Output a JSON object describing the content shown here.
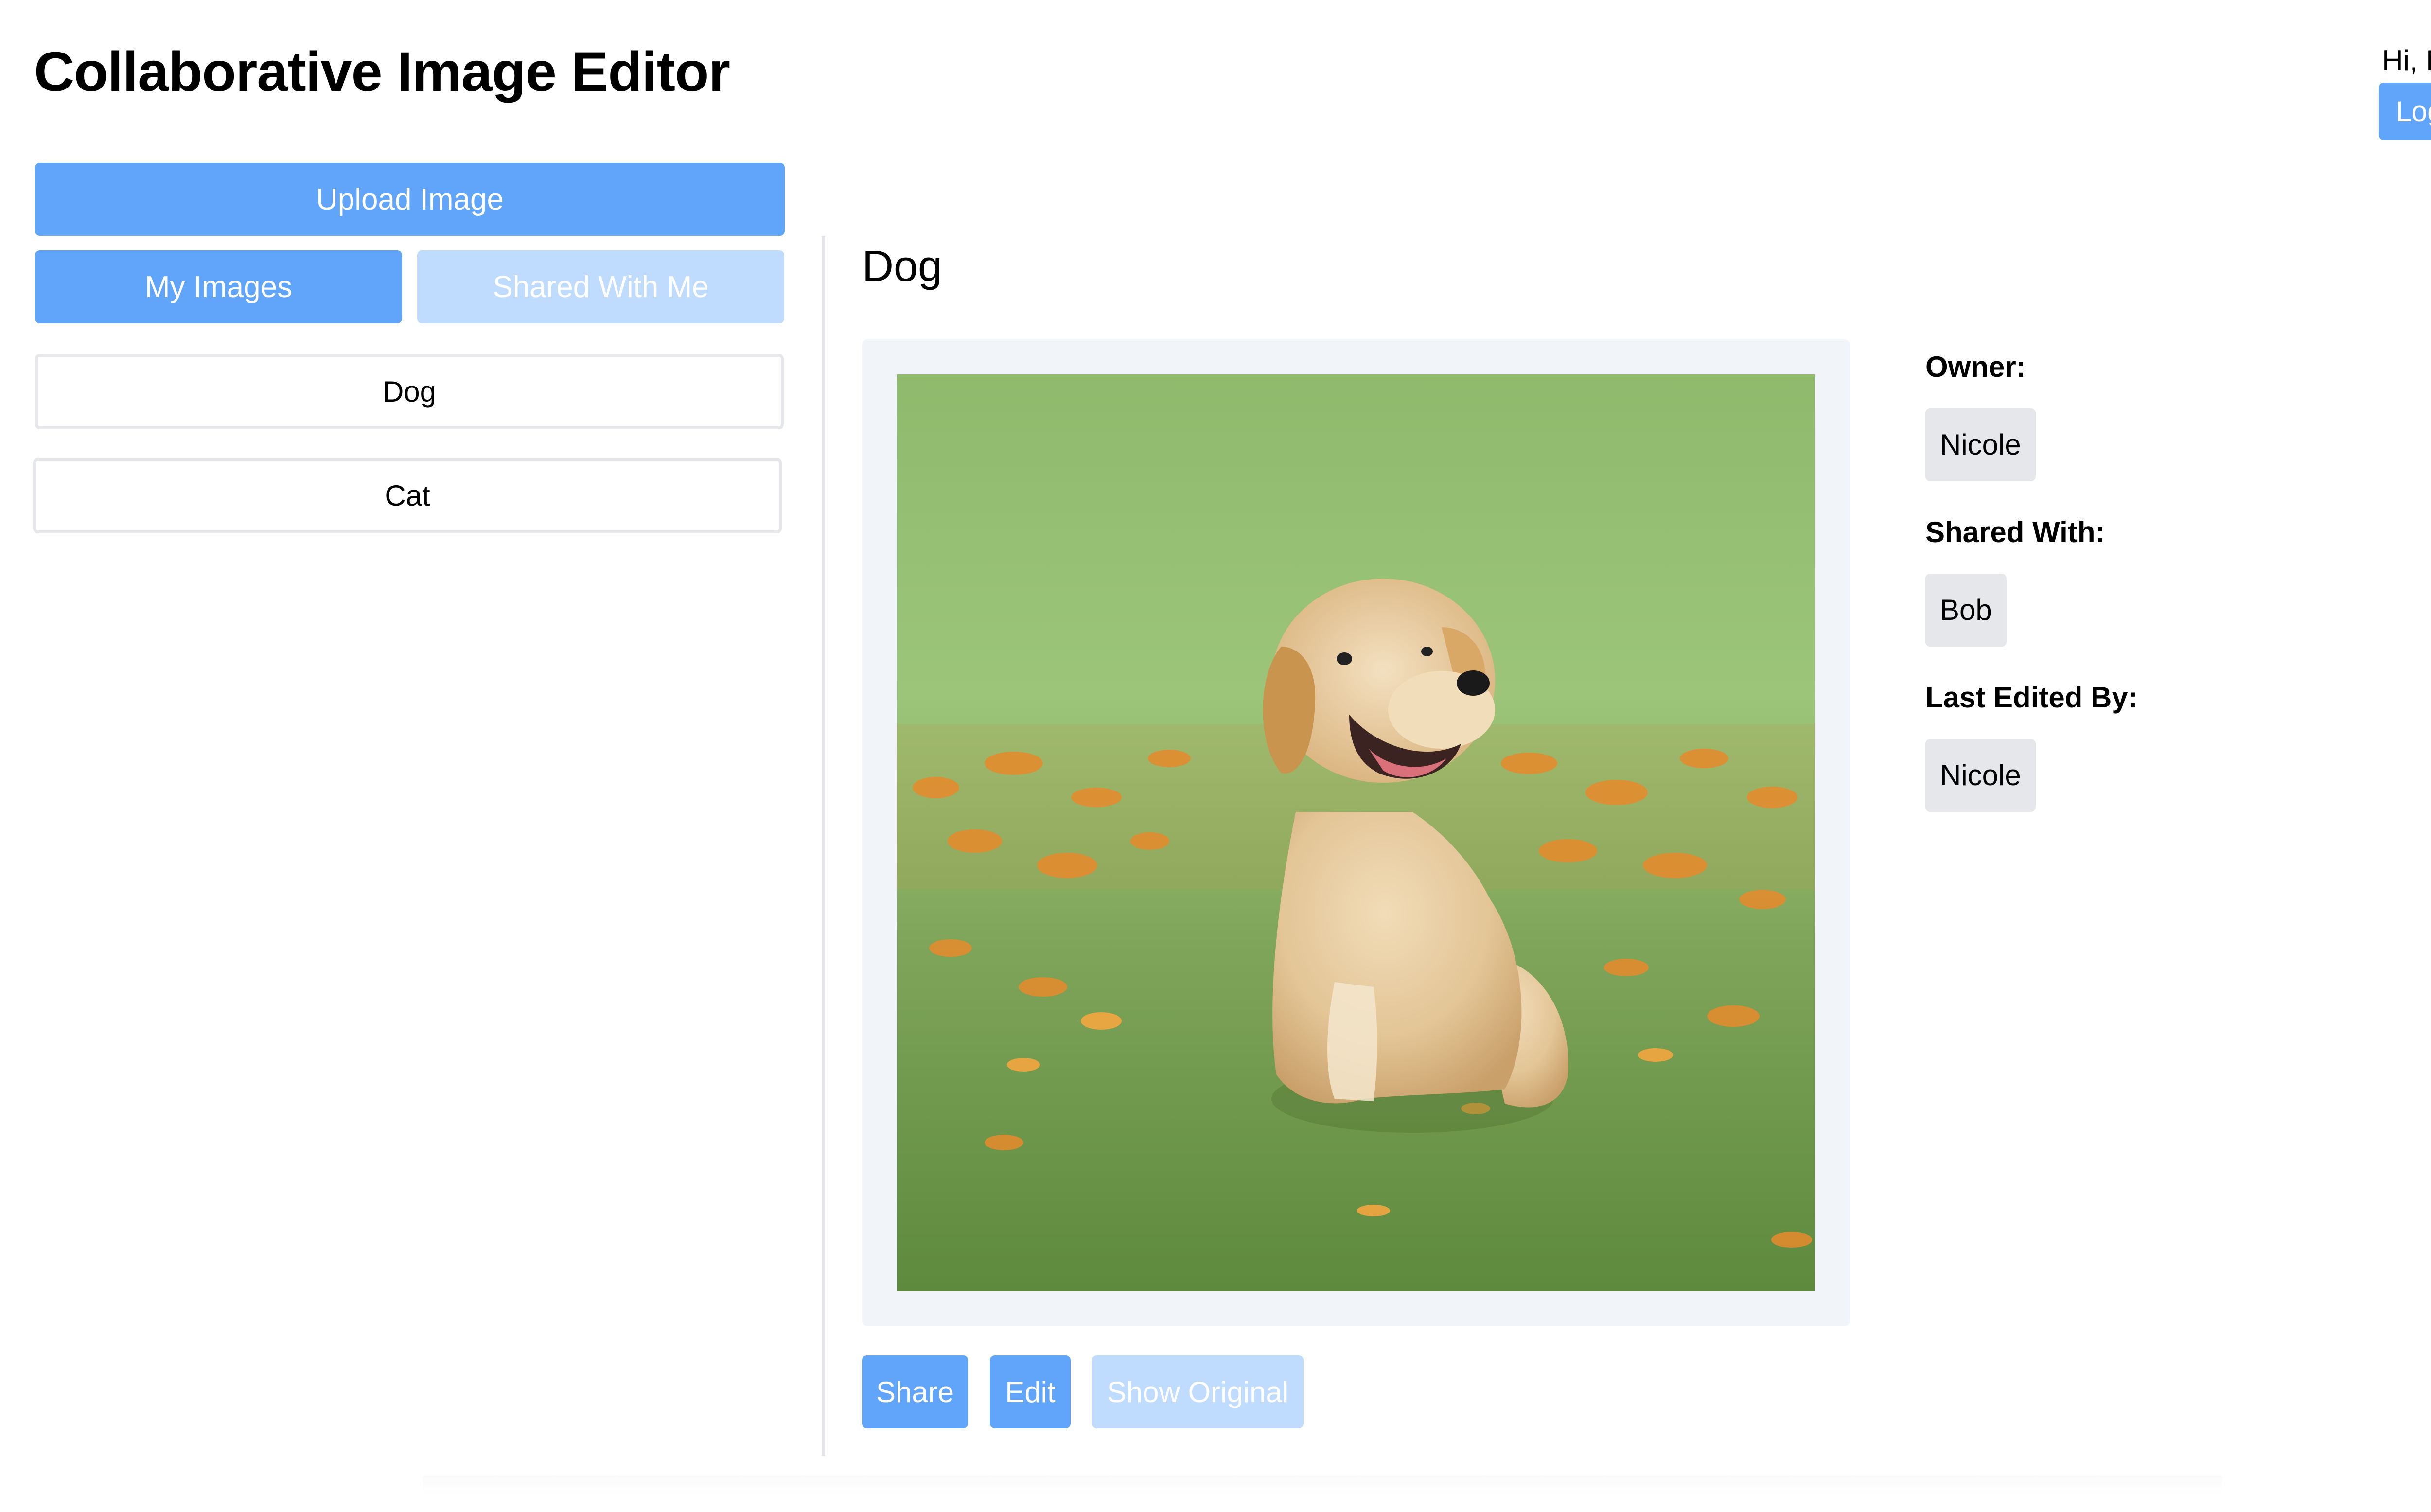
{
  "app": {
    "title": "Collaborative Image Editor"
  },
  "user": {
    "greeting": "Hi, Nicole",
    "logout_label": "Log out"
  },
  "sidebar": {
    "upload_label": "Upload Image",
    "tabs": [
      {
        "label": "My Images",
        "active": true
      },
      {
        "label": "Shared With Me",
        "active": false
      }
    ],
    "images": [
      {
        "label": "Dog"
      },
      {
        "label": "Cat"
      }
    ]
  },
  "main": {
    "image_title": "Dog",
    "actions": {
      "share_label": "Share",
      "edit_label": "Edit",
      "show_original_label": "Show Original"
    },
    "info": {
      "owner_label": "Owner:",
      "owner": "Nicole",
      "shared_with_label": "Shared With:",
      "shared_with": [
        "Bob"
      ],
      "last_edited_label": "Last Edited By:",
      "last_edited_by": "Nicole"
    }
  },
  "colors": {
    "primary": "#60a5fa",
    "primary_disabled": "#bfdbfe",
    "chip_bg": "#e5e7eb",
    "frame_bg": "#f1f5f9"
  }
}
